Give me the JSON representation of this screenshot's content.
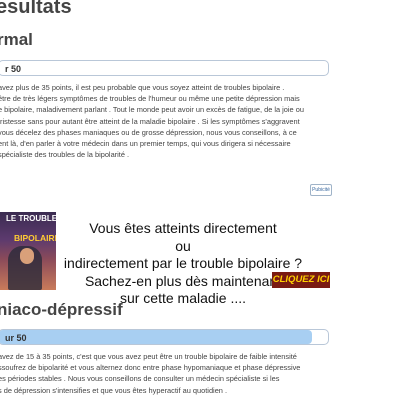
{
  "page": {
    "title": "esultats"
  },
  "section_normal": {
    "heading": "rmal",
    "score_label": "r 50",
    "score_fill": 0,
    "lines": [
      "avez plus de 35 points, il est peu probable que vous soyez atteint de troubles bipolaire .",
      "être de très légers symptômes de troubles de l'humeur ou même une petite dépression mais",
      "e bipolaire, maladivement parlant . Tout le monde peut avoir un excès de fatigue, de la joie ou",
      "tristesse sans pour autant être atteint de la maladie bipolaire . Si les symptômes s'aggravent",
      "vous décelez des phases maniaques ou de grosse dépression, nous vous conseillons, à ce",
      "ent là, d'en parler à votre médecin dans un premier temps, qui vous dirigera si nécessaire",
      "spécialiste des troubles de la bipolarité ."
    ]
  },
  "ad": {
    "badge": "Pubicité",
    "image_line1": "LE TROUBLE",
    "image_line2": "BIPOLAIRE",
    "text_lines": [
      "Vous êtes atteints directement",
      "ou",
      "indirectement par le trouble bipolaire ?",
      "Sachez-en plus dès maintenant",
      "sur cette maladie ...."
    ],
    "cta": "CLIQUEZ ICI"
  },
  "section_maniaco": {
    "heading": "niaco-dépressif",
    "score_label": "ur 50",
    "score_fill": 0.95,
    "lines": [
      "avez de 15 à 35 points, c'est que vous avez peut être un trouble bipolaire de faible intensité",
      "ssoufrez de bipolarité et vous alternez donc entre phase hypomaniaque et phase dépressive",
      "es périodes stables . Nous vous conseillons de consulter un médecin spécialiste si les",
      "s de dépression s'intensifies et que vous êtes hyperactif au quotidien ."
    ]
  }
}
